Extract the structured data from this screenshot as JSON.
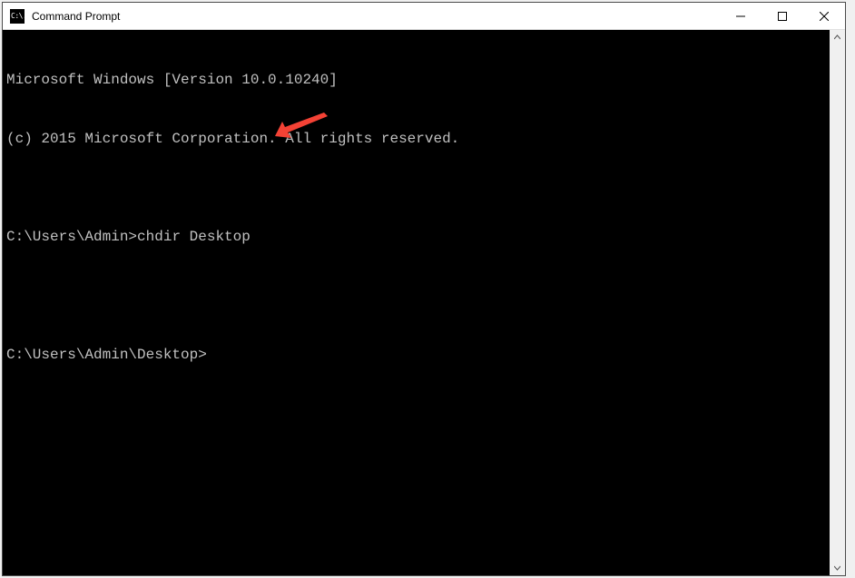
{
  "window": {
    "title": "Command Prompt",
    "icon_text": "C:\\."
  },
  "terminal": {
    "lines": [
      "Microsoft Windows [Version 10.0.10240]",
      "(c) 2015 Microsoft Corporation. All rights reserved.",
      ""
    ],
    "prompts": [
      {
        "prompt": "C:\\Users\\Admin>",
        "command": "chdir Desktop"
      },
      {
        "prompt": "C:\\Users\\Admin\\Desktop>",
        "command": ""
      }
    ]
  },
  "annotation": {
    "arrow_color": "#f44336"
  }
}
